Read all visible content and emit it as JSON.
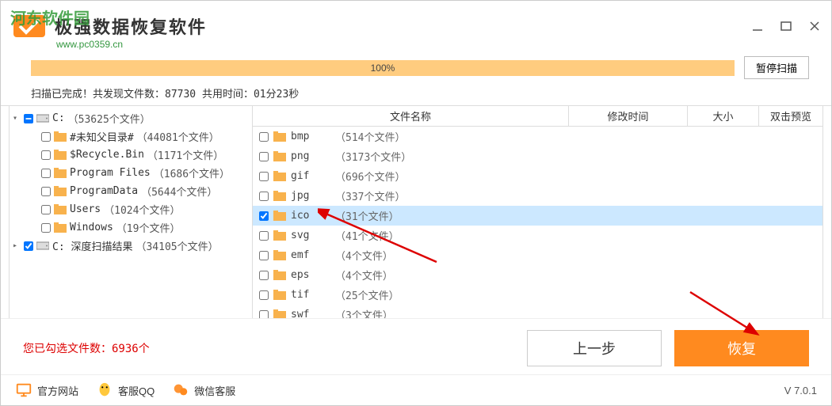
{
  "app": {
    "title": "极强数据恢复软件"
  },
  "watermark": {
    "text": "河东软件园",
    "url": "www.pc0359.cn"
  },
  "progress": {
    "percent": "100%",
    "pause": "暂停扫描"
  },
  "status": "扫描已完成！共发现文件数：87730   共用时间：01分23秒",
  "tree": [
    {
      "label": "C:",
      "count": "（53625个文件）",
      "level": 0,
      "drive": true,
      "expanded": true,
      "state": "partial"
    },
    {
      "label": "#未知父目录#",
      "count": "（44081个文件）",
      "level": 1
    },
    {
      "label": "$Recycle.Bin",
      "count": "（1171个文件）",
      "level": 1
    },
    {
      "label": "Program Files",
      "count": "（1686个文件）",
      "level": 1
    },
    {
      "label": "ProgramData",
      "count": "（5644个文件）",
      "level": 1
    },
    {
      "label": "Users",
      "count": "（1024个文件）",
      "level": 1
    },
    {
      "label": "Windows",
      "count": "（19个文件）",
      "level": 1
    },
    {
      "label": "C: 深度扫描结果",
      "count": "（34105个文件）",
      "level": 0,
      "drive": true,
      "state": "checked"
    }
  ],
  "columns": {
    "name": "文件名称",
    "time": "修改时间",
    "size": "大小",
    "preview": "双击预览"
  },
  "files": [
    {
      "name": "bmp",
      "count": "（514个文件）"
    },
    {
      "name": "png",
      "count": "（3173个文件）"
    },
    {
      "name": "gif",
      "count": "（696个文件）"
    },
    {
      "name": "jpg",
      "count": "（337个文件）"
    },
    {
      "name": "ico",
      "count": "（31个文件）",
      "checked": true,
      "selected": true
    },
    {
      "name": "svg",
      "count": "（41个文件）"
    },
    {
      "name": "emf",
      "count": "（4个文件）"
    },
    {
      "name": "eps",
      "count": "（4个文件）"
    },
    {
      "name": "tif",
      "count": "（25个文件）"
    },
    {
      "name": "swf",
      "count": "（3个文件）"
    }
  ],
  "selected_text": "您已勾选文件数：6936个",
  "buttons": {
    "prev": "上一步",
    "recover": "恢复"
  },
  "links": {
    "web": "官方网站",
    "qq": "客服QQ",
    "wechat": "微信客服"
  },
  "version": "V 7.0.1"
}
